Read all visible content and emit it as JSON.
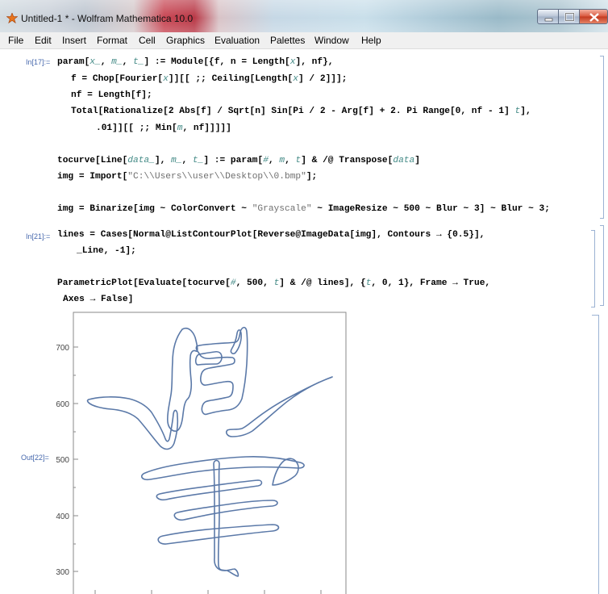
{
  "window": {
    "title": "Untitled-1 * - Wolfram Mathematica 10.0",
    "icon": "mathematica-icon"
  },
  "menu": [
    "File",
    "Edit",
    "Insert",
    "Format",
    "Cell",
    "Graphics",
    "Evaluation",
    "Palettes",
    "Window",
    "Help"
  ],
  "cells": {
    "in17_label": "In[17]:=",
    "in21_label": "In[21]:=",
    "out22_label": "Out[22]="
  },
  "plot": {
    "y_ticks": [
      "700",
      "600",
      "500",
      "400",
      "300"
    ],
    "frame": true,
    "axes": false,
    "stroke_color": "#5b79a8"
  }
}
